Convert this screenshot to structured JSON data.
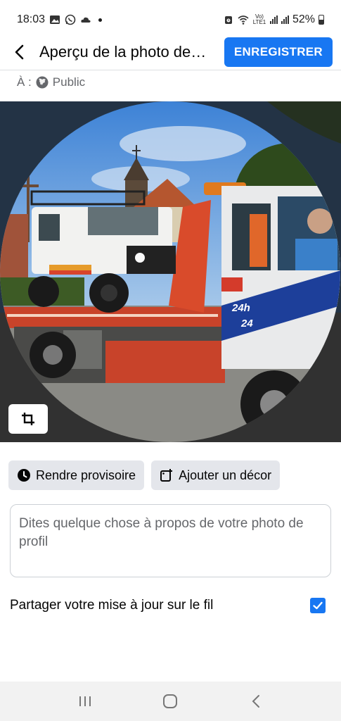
{
  "status_bar": {
    "time": "18:03",
    "battery": "52%",
    "network_label": "Vo) LTE1",
    "icons": [
      "gallery-icon",
      "whatsapp-icon",
      "cloud-icon",
      "alarm-icon",
      "wifi-icon",
      "signal-icon",
      "battery-icon"
    ]
  },
  "header": {
    "title": "Aperçu de la photo de…",
    "save_label": "ENREGISTRER"
  },
  "audience": {
    "prefix": "À :",
    "value": "Public"
  },
  "photo": {
    "sign_text_1": "24h",
    "sign_text_2": "24"
  },
  "chips": {
    "temporary_label": "Rendre provisoire",
    "frame_label": "Ajouter un décor"
  },
  "caption": {
    "placeholder": "Dites quelque chose à propos de votre photo de profil",
    "value": ""
  },
  "share": {
    "label": "Partager votre mise à jour sur le fil",
    "checked": true
  },
  "colors": {
    "accent": "#1877f2",
    "chip_bg": "#e4e6eb",
    "secondary_text": "#65676b"
  }
}
